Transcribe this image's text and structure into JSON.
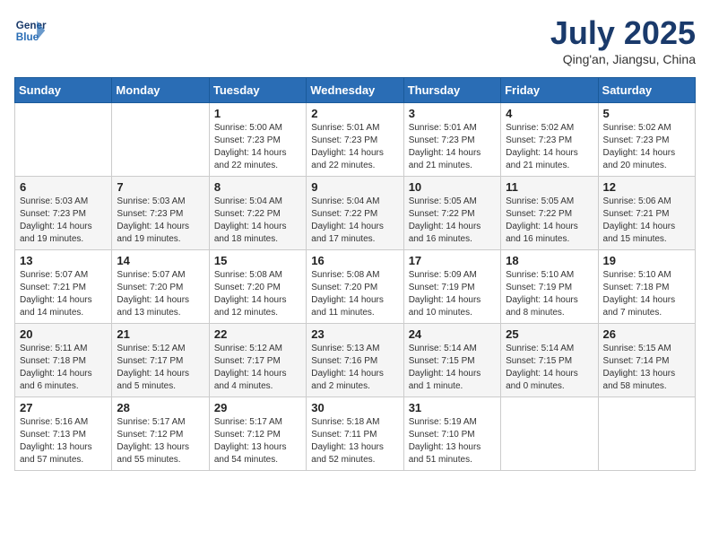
{
  "header": {
    "logo_line1": "General",
    "logo_line2": "Blue",
    "month_title": "July 2025",
    "location": "Qing'an, Jiangsu, China"
  },
  "weekdays": [
    "Sunday",
    "Monday",
    "Tuesday",
    "Wednesday",
    "Thursday",
    "Friday",
    "Saturday"
  ],
  "weeks": [
    [
      {
        "day": "",
        "info": ""
      },
      {
        "day": "",
        "info": ""
      },
      {
        "day": "1",
        "info": "Sunrise: 5:00 AM\nSunset: 7:23 PM\nDaylight: 14 hours\nand 22 minutes."
      },
      {
        "day": "2",
        "info": "Sunrise: 5:01 AM\nSunset: 7:23 PM\nDaylight: 14 hours\nand 22 minutes."
      },
      {
        "day": "3",
        "info": "Sunrise: 5:01 AM\nSunset: 7:23 PM\nDaylight: 14 hours\nand 21 minutes."
      },
      {
        "day": "4",
        "info": "Sunrise: 5:02 AM\nSunset: 7:23 PM\nDaylight: 14 hours\nand 21 minutes."
      },
      {
        "day": "5",
        "info": "Sunrise: 5:02 AM\nSunset: 7:23 PM\nDaylight: 14 hours\nand 20 minutes."
      }
    ],
    [
      {
        "day": "6",
        "info": "Sunrise: 5:03 AM\nSunset: 7:23 PM\nDaylight: 14 hours\nand 19 minutes."
      },
      {
        "day": "7",
        "info": "Sunrise: 5:03 AM\nSunset: 7:23 PM\nDaylight: 14 hours\nand 19 minutes."
      },
      {
        "day": "8",
        "info": "Sunrise: 5:04 AM\nSunset: 7:22 PM\nDaylight: 14 hours\nand 18 minutes."
      },
      {
        "day": "9",
        "info": "Sunrise: 5:04 AM\nSunset: 7:22 PM\nDaylight: 14 hours\nand 17 minutes."
      },
      {
        "day": "10",
        "info": "Sunrise: 5:05 AM\nSunset: 7:22 PM\nDaylight: 14 hours\nand 16 minutes."
      },
      {
        "day": "11",
        "info": "Sunrise: 5:05 AM\nSunset: 7:22 PM\nDaylight: 14 hours\nand 16 minutes."
      },
      {
        "day": "12",
        "info": "Sunrise: 5:06 AM\nSunset: 7:21 PM\nDaylight: 14 hours\nand 15 minutes."
      }
    ],
    [
      {
        "day": "13",
        "info": "Sunrise: 5:07 AM\nSunset: 7:21 PM\nDaylight: 14 hours\nand 14 minutes."
      },
      {
        "day": "14",
        "info": "Sunrise: 5:07 AM\nSunset: 7:20 PM\nDaylight: 14 hours\nand 13 minutes."
      },
      {
        "day": "15",
        "info": "Sunrise: 5:08 AM\nSunset: 7:20 PM\nDaylight: 14 hours\nand 12 minutes."
      },
      {
        "day": "16",
        "info": "Sunrise: 5:08 AM\nSunset: 7:20 PM\nDaylight: 14 hours\nand 11 minutes."
      },
      {
        "day": "17",
        "info": "Sunrise: 5:09 AM\nSunset: 7:19 PM\nDaylight: 14 hours\nand 10 minutes."
      },
      {
        "day": "18",
        "info": "Sunrise: 5:10 AM\nSunset: 7:19 PM\nDaylight: 14 hours\nand 8 minutes."
      },
      {
        "day": "19",
        "info": "Sunrise: 5:10 AM\nSunset: 7:18 PM\nDaylight: 14 hours\nand 7 minutes."
      }
    ],
    [
      {
        "day": "20",
        "info": "Sunrise: 5:11 AM\nSunset: 7:18 PM\nDaylight: 14 hours\nand 6 minutes."
      },
      {
        "day": "21",
        "info": "Sunrise: 5:12 AM\nSunset: 7:17 PM\nDaylight: 14 hours\nand 5 minutes."
      },
      {
        "day": "22",
        "info": "Sunrise: 5:12 AM\nSunset: 7:17 PM\nDaylight: 14 hours\nand 4 minutes."
      },
      {
        "day": "23",
        "info": "Sunrise: 5:13 AM\nSunset: 7:16 PM\nDaylight: 14 hours\nand 2 minutes."
      },
      {
        "day": "24",
        "info": "Sunrise: 5:14 AM\nSunset: 7:15 PM\nDaylight: 14 hours\nand 1 minute."
      },
      {
        "day": "25",
        "info": "Sunrise: 5:14 AM\nSunset: 7:15 PM\nDaylight: 14 hours\nand 0 minutes."
      },
      {
        "day": "26",
        "info": "Sunrise: 5:15 AM\nSunset: 7:14 PM\nDaylight: 13 hours\nand 58 minutes."
      }
    ],
    [
      {
        "day": "27",
        "info": "Sunrise: 5:16 AM\nSunset: 7:13 PM\nDaylight: 13 hours\nand 57 minutes."
      },
      {
        "day": "28",
        "info": "Sunrise: 5:17 AM\nSunset: 7:12 PM\nDaylight: 13 hours\nand 55 minutes."
      },
      {
        "day": "29",
        "info": "Sunrise: 5:17 AM\nSunset: 7:12 PM\nDaylight: 13 hours\nand 54 minutes."
      },
      {
        "day": "30",
        "info": "Sunrise: 5:18 AM\nSunset: 7:11 PM\nDaylight: 13 hours\nand 52 minutes."
      },
      {
        "day": "31",
        "info": "Sunrise: 5:19 AM\nSunset: 7:10 PM\nDaylight: 13 hours\nand 51 minutes."
      },
      {
        "day": "",
        "info": ""
      },
      {
        "day": "",
        "info": ""
      }
    ]
  ]
}
